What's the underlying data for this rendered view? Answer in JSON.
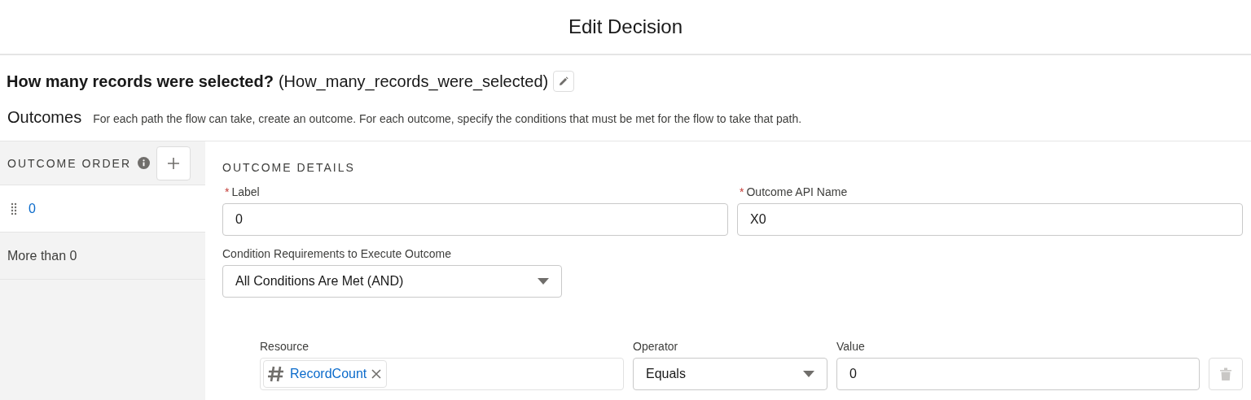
{
  "window": {
    "title": "Edit Decision"
  },
  "element": {
    "name": "How many records were selected?",
    "api_name": "(How_many_records_were_selected)"
  },
  "outcomes_section": {
    "title": "Outcomes",
    "description": "For each path the flow can take, create an outcome. For each outcome, specify the conditions that must be met for the flow to take that path."
  },
  "outcome_order": {
    "title": "OUTCOME ORDER",
    "items": [
      {
        "label": "0",
        "selected": true
      },
      {
        "label": "More than 0",
        "selected": false
      }
    ]
  },
  "outcome_details": {
    "title": "OUTCOME DETAILS",
    "label_field": {
      "required_mark": "*",
      "label": "Label",
      "value": "0"
    },
    "api_name_field": {
      "required_mark": "*",
      "label": "Outcome API Name",
      "value": "X0"
    },
    "condition_requirements": {
      "label": "Condition Requirements to Execute Outcome",
      "value": "All Conditions Are Met (AND)"
    },
    "conditions": [
      {
        "resource": {
          "label": "Resource",
          "pill": "RecordCount"
        },
        "operator": {
          "label": "Operator",
          "value": "Equals"
        },
        "value": {
          "label": "Value",
          "value": "0"
        },
        "delete_disabled": true
      }
    ]
  }
}
